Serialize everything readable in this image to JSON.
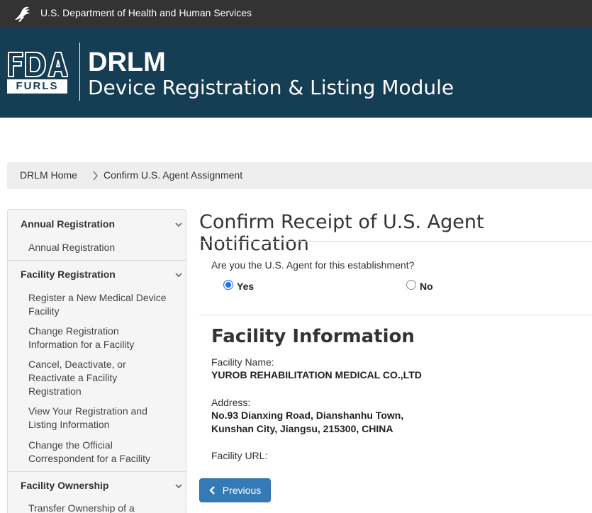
{
  "hhs_bar": {
    "text": "U.S. Department of Health and Human Services"
  },
  "header": {
    "logo_fda": "FDA",
    "logo_furls": "FURLS",
    "title": "DRLM",
    "subtitle": "Device Registration & Listing Module"
  },
  "breadcrumb": {
    "home": "DRLM Home",
    "separator": ">",
    "current": "Confirm U.S. Agent Assignment"
  },
  "sidebar": {
    "sections": [
      {
        "header": "Annual Registration",
        "items": [
          "Annual Registration"
        ]
      },
      {
        "header": "Facility Registration",
        "items": [
          "Register a New Medical Device Facility",
          "Change Registration Information for a Facility",
          "Cancel, Deactivate, or Reactivate a Facility Registration",
          "View Your Registration and Listing Information",
          "Change the Official Correspondent for a Facility"
        ]
      },
      {
        "header": "Facility Ownership",
        "items": [
          "Transfer Ownership of a"
        ]
      }
    ]
  },
  "main": {
    "title": "Confirm Receipt of U.S. Agent Notification",
    "question": "Are you the U.S. Agent for this establishment?",
    "options": {
      "yes": "Yes",
      "no": "No",
      "selected": "yes"
    },
    "facility_title": "Facility Information",
    "facility_name_label": "Facility Name:",
    "facility_name": "YUROB REHABILITATION MEDICAL CO.,LTD",
    "address_label": "Address:",
    "address_line1": "No.93 Dianxing Road, Dianshanhu Town,",
    "address_line2": "Kunshan City, Jiangsu, 215300, CHINA",
    "url_label": "Facility URL:",
    "url_value": "",
    "previous_button": "Previous"
  },
  "colors": {
    "hhs_bar": "#333333",
    "header_bg": "#153d53",
    "button": "#337ab7",
    "radio_accent": "#1a73e8"
  }
}
